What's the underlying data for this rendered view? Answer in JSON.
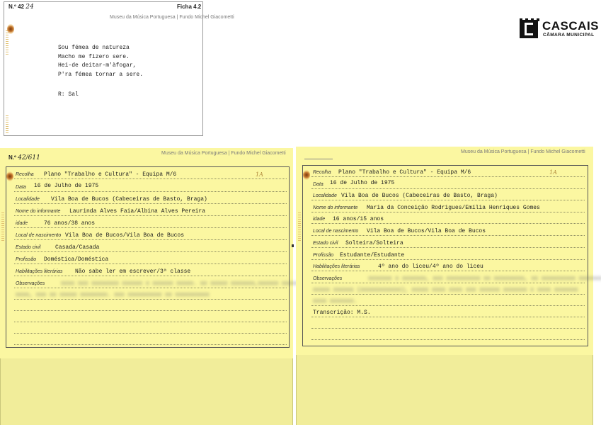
{
  "brand": {
    "name": "CASCAIS",
    "subtitle": "CÂMARA MUNICIPAL"
  },
  "ficha": {
    "number_label": "N.º",
    "number_value": "42",
    "number_hand": "24",
    "museum": "Museu da Música Portuguesa | Fundo Michel Giacometti",
    "ficha_label": "Ficha 4.2",
    "lines": [
      "Sou fémea de natureza",
      "Macho me fizero sere.",
      "Hei-de deitar-m'àfogar,",
      "P'ra fémea tornar a sere."
    ],
    "answer": "R: Sal"
  },
  "card_a": {
    "number_label": "N.º",
    "number_hand": "42/611",
    "museum": "Museu da Música Portuguesa | Fundo Michel Giacometti",
    "fields": [
      {
        "label": "Recolha",
        "value": "Plano \"Trabalho e Cultura\" - Equipa M/6",
        "mark": "1A"
      },
      {
        "label": "Data",
        "value": "16 de Julho de 1975"
      },
      {
        "label": "Localidade",
        "value": "Vila Boa de Bucos (Cabeceiras de Basto, Braga)"
      },
      {
        "label": "Nome do informante",
        "value": "Laurinda Alves Faia/Albina Alves Pereira"
      },
      {
        "label": "idade",
        "value": "76 anos/38 anos"
      },
      {
        "label": "Local de nascimento",
        "value": "Vila Boa de Bucos/Vila Boa de Bucos"
      },
      {
        "label": "Estado civil",
        "value": "Casada/Casada"
      },
      {
        "label": "Profissão",
        "value": "Doméstica/Doméstica"
      },
      {
        "label": "Habilitações literárias",
        "value": "Não sabe ler em escrever/3ª classe"
      },
      {
        "label": "Observações",
        "value": ""
      }
    ]
  },
  "card_b": {
    "museum": "Museu da Música Portuguesa | Fundo Michel Giacometti",
    "fields": [
      {
        "label": "Recolha",
        "value": "Plano \"Trabalho e Cultura\" - Equipa M/6",
        "mark": "1A"
      },
      {
        "label": "Data",
        "value": "16 de Julho de 1975"
      },
      {
        "label": "Localidade",
        "value": "Vila Boa de Bucos (Cabeceiras de Basto, Braga)"
      },
      {
        "label": "Nome do informante",
        "value": "Maria da Conceição Rodrigues/Emília Henriques Gomes"
      },
      {
        "label": "idade",
        "value": "16 anos/15 anos"
      },
      {
        "label": "Local de nascimento",
        "value": "Vila Boa de Bucos/Vila Boa de Bucos"
      },
      {
        "label": "Estado civil",
        "value": "Solteira/Solteira"
      },
      {
        "label": "Profissão",
        "value": "Estudante/Estudante"
      },
      {
        "label": "Habilitações literárias",
        "value": "4º ano do liceu/4º ano do liceu"
      },
      {
        "label": "Observações",
        "value": ""
      }
    ],
    "transcription": "Transcrição: M.S."
  }
}
